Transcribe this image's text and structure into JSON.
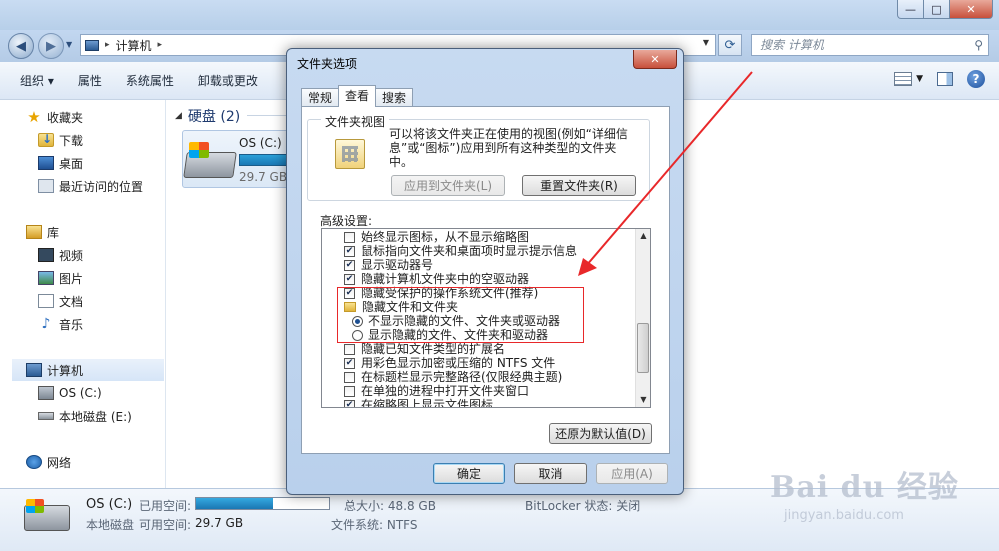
{
  "explorer": {
    "breadcrumb": [
      "计算机"
    ],
    "search_placeholder": "搜索 计算机",
    "window_controls": {
      "minimize": "—",
      "maximize": "□",
      "close": "✕"
    },
    "toolbar": [
      "组织 ▾",
      "属性",
      "系统属性",
      "卸载或更改"
    ],
    "sidebar": {
      "favorites": {
        "label": "收藏夹",
        "items": [
          "下载",
          "桌面",
          "最近访问的位置"
        ]
      },
      "libraries": {
        "label": "库",
        "items": [
          "视频",
          "图片",
          "文档",
          "音乐"
        ]
      },
      "computer": {
        "label": "计算机",
        "items": [
          "OS (C:)",
          "本地磁盘 (E:)"
        ]
      },
      "network": {
        "label": "网络"
      }
    },
    "main": {
      "group": "硬盘 (2)",
      "tile": {
        "name": "OS (C:)",
        "free": "29.7 GB"
      }
    },
    "details": {
      "name": "OS (C:)",
      "type": "本地磁盘",
      "used_label": "已用空间:",
      "free_label": "可用空间:",
      "free_value": "29.7 GB",
      "used_fraction": 0.58,
      "total": "总大小: 48.8 GB",
      "fs": "文件系统: NTFS",
      "bitlocker": "BitLocker 状态: 关闭"
    }
  },
  "dialog": {
    "title": "文件夹选项",
    "close": "✕",
    "tabs": [
      "常规",
      "查看",
      "搜索"
    ],
    "folder_view": {
      "legend": "文件夹视图",
      "description": "可以将该文件夹正在使用的视图(例如“详细信息”或“图标”)应用到所有这种类型的文件夹中。",
      "apply_button": "应用到文件夹(L)",
      "reset_button": "重置文件夹(R)"
    },
    "advanced_label": "高级设置:",
    "advanced_items": [
      {
        "kind": "check",
        "checked": false,
        "label": "始终显示图标，从不显示缩略图",
        "indent": 1
      },
      {
        "kind": "check",
        "checked": true,
        "label": "鼠标指向文件夹和桌面项时显示提示信息",
        "indent": 1
      },
      {
        "kind": "check",
        "checked": true,
        "label": "显示驱动器号",
        "indent": 1
      },
      {
        "kind": "check",
        "checked": true,
        "label": "隐藏计算机文件夹中的空驱动器",
        "indent": 1
      },
      {
        "kind": "check",
        "checked": true,
        "label": "隐藏受保护的操作系统文件(推荐)",
        "indent": 1
      },
      {
        "kind": "folder",
        "label": "隐藏文件和文件夹",
        "indent": 1
      },
      {
        "kind": "radio",
        "checked": true,
        "label": "不显示隐藏的文件、文件夹或驱动器",
        "indent": 2
      },
      {
        "kind": "radio",
        "checked": false,
        "label": "显示隐藏的文件、文件夹和驱动器",
        "indent": 2
      },
      {
        "kind": "check",
        "checked": false,
        "label": "隐藏已知文件类型的扩展名",
        "indent": 1
      },
      {
        "kind": "check",
        "checked": true,
        "label": "用彩色显示加密或压缩的 NTFS 文件",
        "indent": 1
      },
      {
        "kind": "check",
        "checked": false,
        "label": "在标题栏显示完整路径(仅限经典主题)",
        "indent": 1
      },
      {
        "kind": "check",
        "checked": false,
        "label": "在单独的进程中打开文件夹窗口",
        "indent": 1
      },
      {
        "kind": "check",
        "checked": true,
        "label": "在缩略图上显示文件图标",
        "indent": 1
      }
    ],
    "restore_defaults": "还原为默认值(D)",
    "ok": "确定",
    "cancel": "取消",
    "apply": "应用(A)"
  },
  "watermark": {
    "brand": "Bai du 经验",
    "url": "jingyan.baidu.com"
  },
  "colors": {
    "highlight_box": "#e8282a",
    "arrow": "#e8282a"
  }
}
